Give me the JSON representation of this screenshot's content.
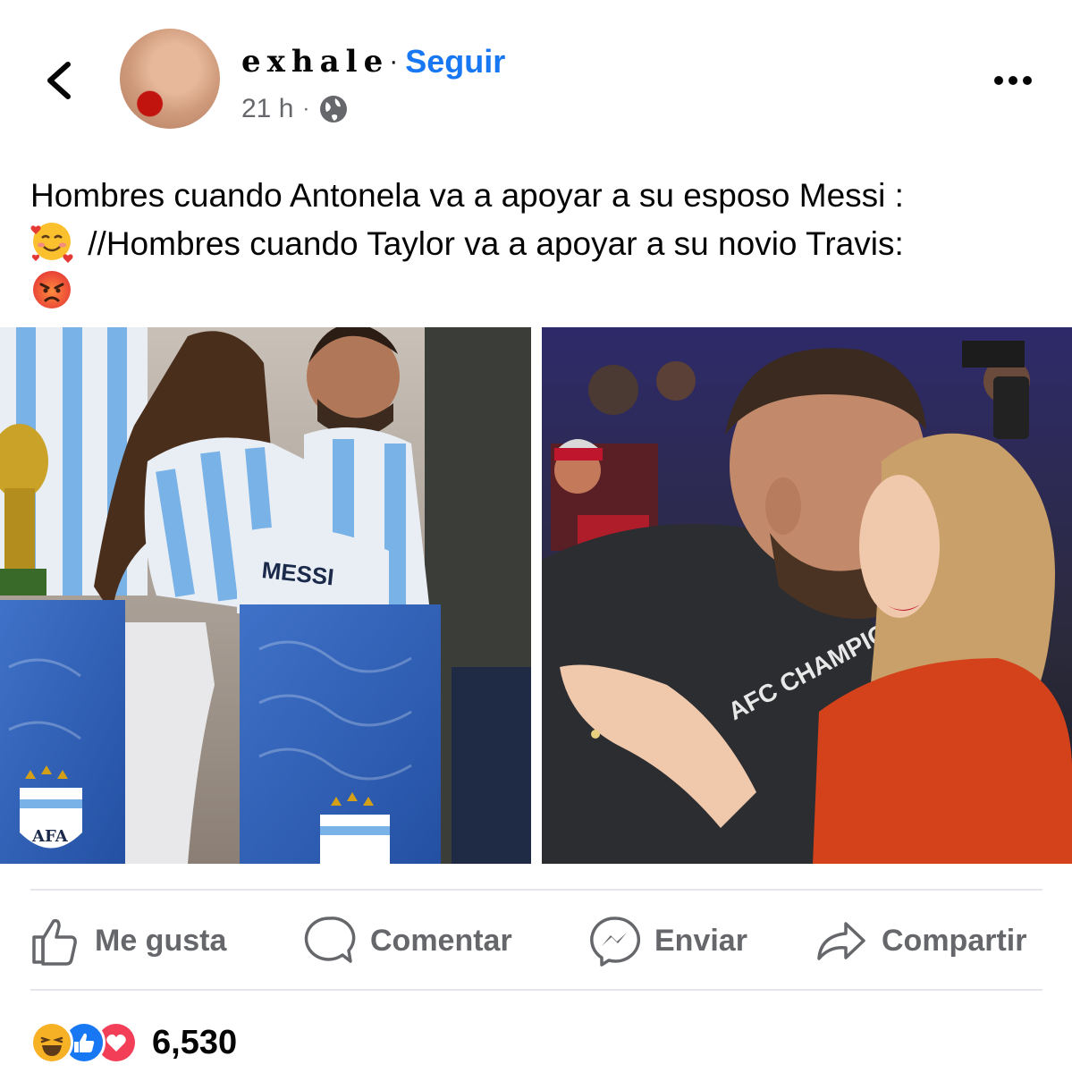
{
  "header": {
    "page_name": "exhale",
    "separator": "·",
    "follow_label": "Seguir",
    "time": "21 h",
    "time_separator": "·",
    "audience_icon": "globe-icon"
  },
  "post": {
    "caption_part1": "Hombres cuando Antonela va a apoyar a su esposo Messi :",
    "caption_emoji1": "smiling-face-with-hearts",
    "caption_part2": " //Hombres cuando Taylor va a apoyar a su novio Travis:",
    "caption_emoji2": "pouting-face",
    "photos": [
      {
        "name": "messi-antonela-photo",
        "jersey_text": "MESSI",
        "logo_text": "AFA"
      },
      {
        "name": "travis-taylor-photo",
        "shirt_text": "AFC CHAMPIONS"
      }
    ]
  },
  "actions": [
    {
      "label": "Me gusta",
      "icon": "thumbs-up-icon"
    },
    {
      "label": "Comentar",
      "icon": "comment-icon"
    },
    {
      "label": "Enviar",
      "icon": "messenger-icon"
    },
    {
      "label": "Compartir",
      "icon": "share-icon"
    }
  ],
  "reactions": {
    "types": [
      "haha",
      "like",
      "love"
    ],
    "count": "6,530"
  },
  "colors": {
    "accent": "#1877f2",
    "muted_text": "#65676b",
    "divider": "#e4e6eb",
    "love": "#f33e58",
    "haha": "#f7b125"
  }
}
